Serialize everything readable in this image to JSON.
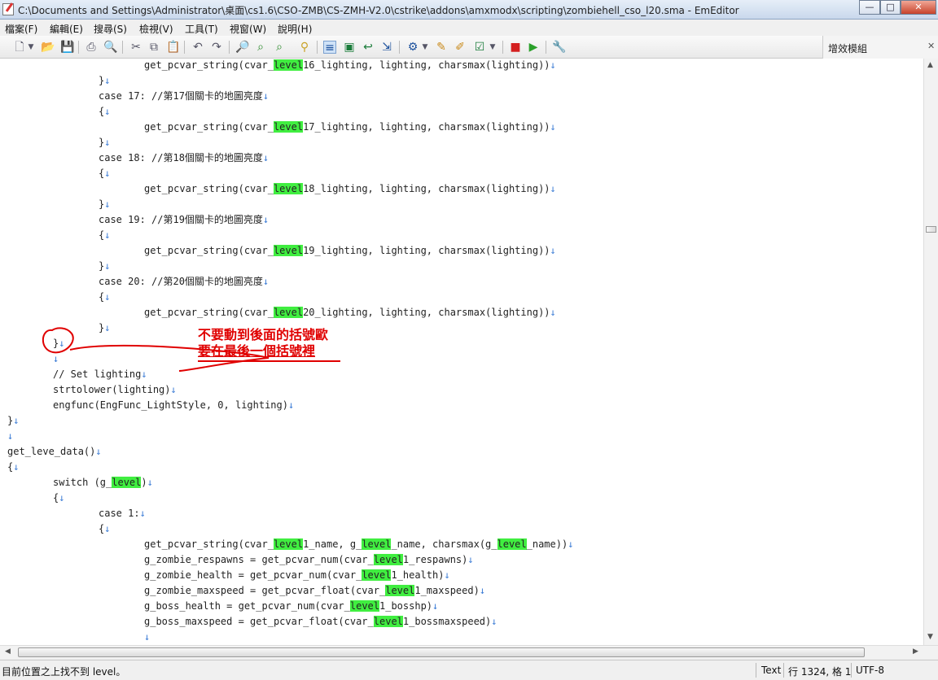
{
  "window": {
    "title": "C:\\Documents and Settings\\Administrator\\桌面\\cs1.6\\CSO-ZMB\\CS-ZMH-V2.0\\cstrike\\addons\\amxmodx\\scripting\\zombiehell_cso_l20.sma - EmEditor",
    "minimize": "—",
    "maximize": "□",
    "close": "✕"
  },
  "menu": {
    "items": [
      "檔案(F)",
      "編輯(E)",
      "搜尋(S)",
      "檢視(V)",
      "工具(T)",
      "視窗(W)",
      "說明(H)"
    ]
  },
  "plugins_panel": {
    "label": "增效模組"
  },
  "code": {
    "lines": [
      [
        {
          "t": "\t\t\tget_pcvar_string(cvar_"
        },
        {
          "t": "level",
          "h": true
        },
        {
          "t": "16_lighting, lighting, charsmax(lighting))"
        },
        {
          "t": "↓",
          "n": true
        }
      ],
      [
        {
          "t": "\t\t}"
        },
        {
          "t": "↓",
          "n": true
        }
      ],
      [
        {
          "t": "\t\tcase 17: //第17個關卡的地圖亮度"
        },
        {
          "t": "↓",
          "n": true
        }
      ],
      [
        {
          "t": "\t\t{"
        },
        {
          "t": "↓",
          "n": true
        }
      ],
      [
        {
          "t": "\t\t\tget_pcvar_string(cvar_"
        },
        {
          "t": "level",
          "h": true
        },
        {
          "t": "17_lighting, lighting, charsmax(lighting))"
        },
        {
          "t": "↓",
          "n": true
        }
      ],
      [
        {
          "t": "\t\t}"
        },
        {
          "t": "↓",
          "n": true
        }
      ],
      [
        {
          "t": "\t\tcase 18: //第18個關卡的地圖亮度"
        },
        {
          "t": "↓",
          "n": true
        }
      ],
      [
        {
          "t": "\t\t{"
        },
        {
          "t": "↓",
          "n": true
        }
      ],
      [
        {
          "t": "\t\t\tget_pcvar_string(cvar_"
        },
        {
          "t": "level",
          "h": true
        },
        {
          "t": "18_lighting, lighting, charsmax(lighting))"
        },
        {
          "t": "↓",
          "n": true
        }
      ],
      [
        {
          "t": "\t\t}"
        },
        {
          "t": "↓",
          "n": true
        }
      ],
      [
        {
          "t": "\t\tcase 19: //第19個關卡的地圖亮度"
        },
        {
          "t": "↓",
          "n": true
        }
      ],
      [
        {
          "t": "\t\t{"
        },
        {
          "t": "↓",
          "n": true
        }
      ],
      [
        {
          "t": "\t\t\tget_pcvar_string(cvar_"
        },
        {
          "t": "level",
          "h": true
        },
        {
          "t": "19_lighting, lighting, charsmax(lighting))"
        },
        {
          "t": "↓",
          "n": true
        }
      ],
      [
        {
          "t": "\t\t}"
        },
        {
          "t": "↓",
          "n": true
        }
      ],
      [
        {
          "t": "\t\tcase 20: //第20個關卡的地圖亮度"
        },
        {
          "t": "↓",
          "n": true
        }
      ],
      [
        {
          "t": "\t\t{"
        },
        {
          "t": "↓",
          "n": true
        }
      ],
      [
        {
          "t": "\t\t\tget_pcvar_string(cvar_"
        },
        {
          "t": "level",
          "h": true
        },
        {
          "t": "20_lighting, lighting, charsmax(lighting))"
        },
        {
          "t": "↓",
          "n": true
        }
      ],
      [
        {
          "t": "\t\t}"
        },
        {
          "t": "↓",
          "n": true
        }
      ],
      [
        {
          "t": "\t}"
        },
        {
          "t": "↓",
          "n": true
        }
      ],
      [
        {
          "t": "\t"
        },
        {
          "t": "↓",
          "n": true
        }
      ],
      [
        {
          "t": "\t// Set lighting"
        },
        {
          "t": "↓",
          "n": true
        }
      ],
      [
        {
          "t": "\tstrtolower(lighting)"
        },
        {
          "t": "↓",
          "n": true
        }
      ],
      [
        {
          "t": "\tengfunc(EngFunc_LightStyle, 0, lighting)"
        },
        {
          "t": "↓",
          "n": true
        }
      ],
      [
        {
          "t": "}"
        },
        {
          "t": "↓",
          "n": true
        }
      ],
      [
        {
          "t": "↓",
          "n": true
        }
      ],
      [
        {
          "t": "get_leve_data()"
        },
        {
          "t": "↓",
          "n": true
        }
      ],
      [
        {
          "t": "{"
        },
        {
          "t": "↓",
          "n": true
        }
      ],
      [
        {
          "t": "\tswitch (g_"
        },
        {
          "t": "level",
          "h": true
        },
        {
          "t": ")"
        },
        {
          "t": "↓",
          "n": true
        }
      ],
      [
        {
          "t": "\t{"
        },
        {
          "t": "↓",
          "n": true
        }
      ],
      [
        {
          "t": "\t\tcase 1:"
        },
        {
          "t": "↓",
          "n": true
        }
      ],
      [
        {
          "t": "\t\t{"
        },
        {
          "t": "↓",
          "n": true
        }
      ],
      [
        {
          "t": "\t\t\tget_pcvar_string(cvar_"
        },
        {
          "t": "level",
          "h": true
        },
        {
          "t": "1_name, g_"
        },
        {
          "t": "level",
          "h": true
        },
        {
          "t": "_name, charsmax(g_"
        },
        {
          "t": "level",
          "h": true
        },
        {
          "t": "_name))"
        },
        {
          "t": "↓",
          "n": true
        }
      ],
      [
        {
          "t": "\t\t\tg_zombie_respawns = get_pcvar_num(cvar_"
        },
        {
          "t": "level",
          "h": true
        },
        {
          "t": "1_respawns)"
        },
        {
          "t": "↓",
          "n": true
        }
      ],
      [
        {
          "t": "\t\t\tg_zombie_health = get_pcvar_num(cvar_"
        },
        {
          "t": "level",
          "h": true
        },
        {
          "t": "1_health)"
        },
        {
          "t": "↓",
          "n": true
        }
      ],
      [
        {
          "t": "\t\t\tg_zombie_maxspeed = get_pcvar_float(cvar_"
        },
        {
          "t": "level",
          "h": true
        },
        {
          "t": "1_maxspeed)"
        },
        {
          "t": "↓",
          "n": true
        }
      ],
      [
        {
          "t": "\t\t\tg_boss_health = get_pcvar_num(cvar_"
        },
        {
          "t": "level",
          "h": true
        },
        {
          "t": "1_bosshp)"
        },
        {
          "t": "↓",
          "n": true
        }
      ],
      [
        {
          "t": "\t\t\tg_boss_maxspeed = get_pcvar_float(cvar_"
        },
        {
          "t": "level",
          "h": true
        },
        {
          "t": "1_bossmaxspeed)"
        },
        {
          "t": "↓",
          "n": true
        }
      ],
      [
        {
          "t": "\t\t\t"
        },
        {
          "t": "↓",
          "n": true
        }
      ]
    ]
  },
  "annotation": {
    "line1": "不要動到後面的括號歐",
    "line2": "要在最後一個括號裡",
    "color": "#e00000"
  },
  "status": {
    "message": "目前位置之上找不到 level。",
    "mode": "Text",
    "position": "行 1324, 格 1",
    "encoding": "UTF-8"
  },
  "colors": {
    "highlight": "#40ee40",
    "newline_mark": "#3a7bd5"
  }
}
